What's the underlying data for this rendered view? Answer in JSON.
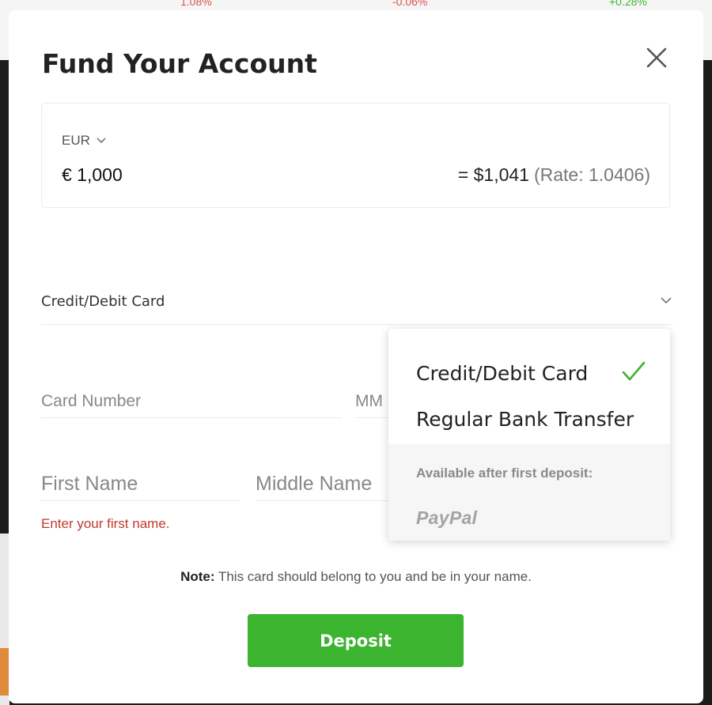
{
  "background": {
    "tickers": [
      "1.08%",
      "-0.06%",
      "+0.28%"
    ]
  },
  "modal": {
    "title": "Fund Your Account",
    "close_icon": "close-icon"
  },
  "amount": {
    "currency": "EUR",
    "value": "€ 1,000",
    "converted": "= $1,041",
    "rate": "(Rate: 1.0406)"
  },
  "payment_method": {
    "selected": "Credit/Debit Card"
  },
  "form": {
    "card_number_placeholder": "Card Number",
    "mm_placeholder": "MM",
    "first_name_placeholder": "First Name",
    "middle_name_placeholder": "Middle Name",
    "first_name_error": "Enter your first name."
  },
  "note": {
    "label": "Note:",
    "text": " This card should belong to you and be in your name."
  },
  "deposit_button": "Deposit",
  "dropdown": {
    "options": [
      "Credit/Debit Card",
      "Regular Bank Transfer"
    ],
    "available_after": "Available after first deposit:",
    "paypal": "PayPal"
  },
  "colors": {
    "accent_green": "#3bb430",
    "error_red": "#c0392b",
    "check_green": "#3bb430"
  }
}
